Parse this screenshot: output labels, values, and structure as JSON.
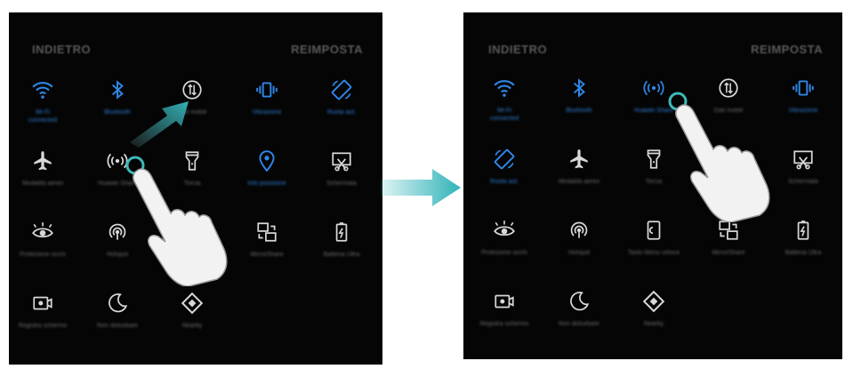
{
  "colors": {
    "accent": "#2f86e6",
    "icon_off": "#d8d8d8",
    "arrow": "#2fb3b8",
    "touch": "#3fb9ba"
  },
  "left_panel": {
    "header": {
      "back": "INDIETRO",
      "reset": "REIMPOSTA"
    },
    "tiles": [
      {
        "label": "Wi-Fi<br>connected",
        "icon": "wifi-icon",
        "on": true
      },
      {
        "label": "Bluetooth",
        "icon": "bluetooth-icon",
        "on": true
      },
      {
        "label": "Dati mobili",
        "icon": "mobile-data-icon",
        "on": false
      },
      {
        "label": "Vibrazione",
        "icon": "vibration-icon",
        "on": true
      },
      {
        "label": "Ruota aut.",
        "icon": "auto-rotate-icon",
        "on": true
      },
      {
        "label": "Modalità aereo",
        "icon": "airplane-icon",
        "on": false
      },
      {
        "label": "Huawei Share",
        "icon": "huawei-share-icon",
        "on": false
      },
      {
        "label": "Torcia",
        "icon": "flashlight-icon",
        "on": false
      },
      {
        "label": "Info posizione",
        "icon": "location-icon",
        "on": true
      },
      {
        "label": "Schermata",
        "icon": "screenshot-icon",
        "on": false
      },
      {
        "label": "Protezione occhi",
        "icon": "eye-comfort-icon",
        "on": false
      },
      {
        "label": "Hotspot",
        "icon": "hotspot-icon",
        "on": false
      },
      {
        "label": "",
        "icon": "none",
        "on": false
      },
      {
        "label": "MirrorShare",
        "icon": "mirrorshare-icon",
        "on": false
      },
      {
        "label": "Batteria Ultra",
        "icon": "battery-saver-icon",
        "on": false
      },
      {
        "label": "Registra schermo",
        "icon": "screen-recorder-icon",
        "on": false
      },
      {
        "label": "Non disturbare",
        "icon": "do-not-disturb-icon",
        "on": false
      },
      {
        "label": "Nearby",
        "icon": "nearby-icon",
        "on": false
      }
    ]
  },
  "right_panel": {
    "header": {
      "back": "INDIETRO",
      "reset": "REIMPOSTA"
    },
    "tiles": [
      {
        "label": "Wi-Fi<br>connected",
        "icon": "wifi-icon",
        "on": true
      },
      {
        "label": "Bluetooth",
        "icon": "bluetooth-icon",
        "on": true
      },
      {
        "label": "Huawei Share",
        "icon": "huawei-share-icon",
        "on": true
      },
      {
        "label": "Dati mobili",
        "icon": "mobile-data-icon",
        "on": false
      },
      {
        "label": "Vibrazione",
        "icon": "vibration-icon",
        "on": true
      },
      {
        "label": "Ruota aut.",
        "icon": "auto-rotate-icon",
        "on": true
      },
      {
        "label": "Modalità aereo",
        "icon": "airplane-icon",
        "on": false
      },
      {
        "label": "Torcia",
        "icon": "flashlight-icon",
        "on": false
      },
      {
        "label": "",
        "icon": "none",
        "on": false
      },
      {
        "label": "Schermata",
        "icon": "screenshot-icon",
        "on": false
      },
      {
        "label": "Protezione occhi",
        "icon": "eye-comfort-icon",
        "on": false
      },
      {
        "label": "Hotspot",
        "icon": "hotspot-icon",
        "on": false
      },
      {
        "label": "Tasto Menu veloce",
        "icon": "floating-dock-icon",
        "on": false
      },
      {
        "label": "MirrorShare",
        "icon": "mirrorshare-icon",
        "on": false
      },
      {
        "label": "Batteria Ultra",
        "icon": "battery-saver-icon",
        "on": false
      },
      {
        "label": "Registra schermo",
        "icon": "screen-recorder-icon",
        "on": false
      },
      {
        "label": "Non disturbare",
        "icon": "do-not-disturb-icon",
        "on": false
      },
      {
        "label": "Nearby",
        "icon": "nearby-icon",
        "on": false
      }
    ]
  }
}
